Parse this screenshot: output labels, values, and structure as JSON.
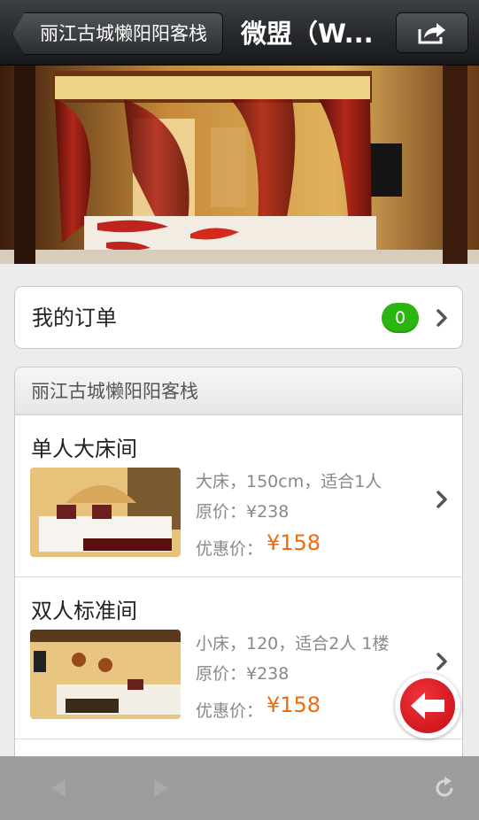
{
  "navbar": {
    "back_label": "丽江古城懒阳阳客栈",
    "title": "微盟（W..."
  },
  "orders": {
    "label": "我的订单",
    "count": "0"
  },
  "hotel": {
    "name": "丽江古城懒阳阳客栈",
    "rooms": [
      {
        "name": "单人大床间",
        "desc": "大床，150cm，适合1人",
        "original_price": "原价：¥238",
        "discount_label": "优惠价：",
        "discount_price": "¥158"
      },
      {
        "name": "双人标准间",
        "desc": "小床，120，适合2人 1楼",
        "original_price": "原价：¥238",
        "discount_label": "优惠价：",
        "discount_price": "¥158"
      }
    ]
  },
  "colors": {
    "accent_price": "#f06a0f",
    "badge_green": "#2bb511",
    "float_red": "#d8141b"
  }
}
